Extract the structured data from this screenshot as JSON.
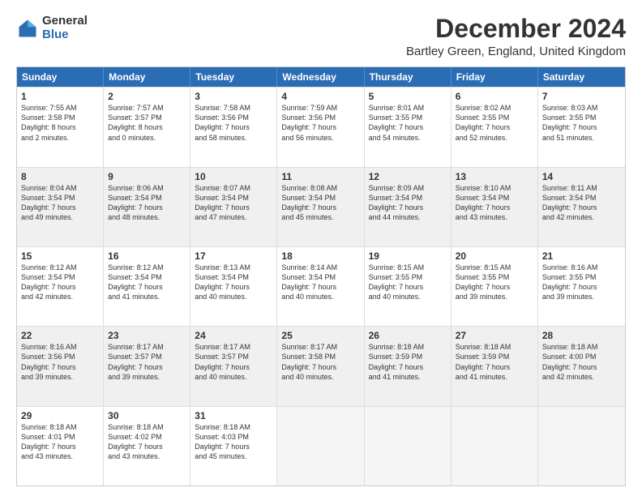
{
  "logo": {
    "general": "General",
    "blue": "Blue"
  },
  "title": "December 2024",
  "subtitle": "Bartley Green, England, United Kingdom",
  "headers": [
    "Sunday",
    "Monday",
    "Tuesday",
    "Wednesday",
    "Thursday",
    "Friday",
    "Saturday"
  ],
  "rows": [
    [
      {
        "day": "1",
        "lines": [
          "Sunrise: 7:55 AM",
          "Sunset: 3:58 PM",
          "Daylight: 8 hours",
          "and 2 minutes."
        ],
        "shaded": false
      },
      {
        "day": "2",
        "lines": [
          "Sunrise: 7:57 AM",
          "Sunset: 3:57 PM",
          "Daylight: 8 hours",
          "and 0 minutes."
        ],
        "shaded": false
      },
      {
        "day": "3",
        "lines": [
          "Sunrise: 7:58 AM",
          "Sunset: 3:56 PM",
          "Daylight: 7 hours",
          "and 58 minutes."
        ],
        "shaded": false
      },
      {
        "day": "4",
        "lines": [
          "Sunrise: 7:59 AM",
          "Sunset: 3:56 PM",
          "Daylight: 7 hours",
          "and 56 minutes."
        ],
        "shaded": false
      },
      {
        "day": "5",
        "lines": [
          "Sunrise: 8:01 AM",
          "Sunset: 3:55 PM",
          "Daylight: 7 hours",
          "and 54 minutes."
        ],
        "shaded": false
      },
      {
        "day": "6",
        "lines": [
          "Sunrise: 8:02 AM",
          "Sunset: 3:55 PM",
          "Daylight: 7 hours",
          "and 52 minutes."
        ],
        "shaded": false
      },
      {
        "day": "7",
        "lines": [
          "Sunrise: 8:03 AM",
          "Sunset: 3:55 PM",
          "Daylight: 7 hours",
          "and 51 minutes."
        ],
        "shaded": false
      }
    ],
    [
      {
        "day": "8",
        "lines": [
          "Sunrise: 8:04 AM",
          "Sunset: 3:54 PM",
          "Daylight: 7 hours",
          "and 49 minutes."
        ],
        "shaded": true
      },
      {
        "day": "9",
        "lines": [
          "Sunrise: 8:06 AM",
          "Sunset: 3:54 PM",
          "Daylight: 7 hours",
          "and 48 minutes."
        ],
        "shaded": true
      },
      {
        "day": "10",
        "lines": [
          "Sunrise: 8:07 AM",
          "Sunset: 3:54 PM",
          "Daylight: 7 hours",
          "and 47 minutes."
        ],
        "shaded": true
      },
      {
        "day": "11",
        "lines": [
          "Sunrise: 8:08 AM",
          "Sunset: 3:54 PM",
          "Daylight: 7 hours",
          "and 45 minutes."
        ],
        "shaded": true
      },
      {
        "day": "12",
        "lines": [
          "Sunrise: 8:09 AM",
          "Sunset: 3:54 PM",
          "Daylight: 7 hours",
          "and 44 minutes."
        ],
        "shaded": true
      },
      {
        "day": "13",
        "lines": [
          "Sunrise: 8:10 AM",
          "Sunset: 3:54 PM",
          "Daylight: 7 hours",
          "and 43 minutes."
        ],
        "shaded": true
      },
      {
        "day": "14",
        "lines": [
          "Sunrise: 8:11 AM",
          "Sunset: 3:54 PM",
          "Daylight: 7 hours",
          "and 42 minutes."
        ],
        "shaded": true
      }
    ],
    [
      {
        "day": "15",
        "lines": [
          "Sunrise: 8:12 AM",
          "Sunset: 3:54 PM",
          "Daylight: 7 hours",
          "and 42 minutes."
        ],
        "shaded": false
      },
      {
        "day": "16",
        "lines": [
          "Sunrise: 8:12 AM",
          "Sunset: 3:54 PM",
          "Daylight: 7 hours",
          "and 41 minutes."
        ],
        "shaded": false
      },
      {
        "day": "17",
        "lines": [
          "Sunrise: 8:13 AM",
          "Sunset: 3:54 PM",
          "Daylight: 7 hours",
          "and 40 minutes."
        ],
        "shaded": false
      },
      {
        "day": "18",
        "lines": [
          "Sunrise: 8:14 AM",
          "Sunset: 3:54 PM",
          "Daylight: 7 hours",
          "and 40 minutes."
        ],
        "shaded": false
      },
      {
        "day": "19",
        "lines": [
          "Sunrise: 8:15 AM",
          "Sunset: 3:55 PM",
          "Daylight: 7 hours",
          "and 40 minutes."
        ],
        "shaded": false
      },
      {
        "day": "20",
        "lines": [
          "Sunrise: 8:15 AM",
          "Sunset: 3:55 PM",
          "Daylight: 7 hours",
          "and 39 minutes."
        ],
        "shaded": false
      },
      {
        "day": "21",
        "lines": [
          "Sunrise: 8:16 AM",
          "Sunset: 3:55 PM",
          "Daylight: 7 hours",
          "and 39 minutes."
        ],
        "shaded": false
      }
    ],
    [
      {
        "day": "22",
        "lines": [
          "Sunrise: 8:16 AM",
          "Sunset: 3:56 PM",
          "Daylight: 7 hours",
          "and 39 minutes."
        ],
        "shaded": true
      },
      {
        "day": "23",
        "lines": [
          "Sunrise: 8:17 AM",
          "Sunset: 3:57 PM",
          "Daylight: 7 hours",
          "and 39 minutes."
        ],
        "shaded": true
      },
      {
        "day": "24",
        "lines": [
          "Sunrise: 8:17 AM",
          "Sunset: 3:57 PM",
          "Daylight: 7 hours",
          "and 40 minutes."
        ],
        "shaded": true
      },
      {
        "day": "25",
        "lines": [
          "Sunrise: 8:17 AM",
          "Sunset: 3:58 PM",
          "Daylight: 7 hours",
          "and 40 minutes."
        ],
        "shaded": true
      },
      {
        "day": "26",
        "lines": [
          "Sunrise: 8:18 AM",
          "Sunset: 3:59 PM",
          "Daylight: 7 hours",
          "and 41 minutes."
        ],
        "shaded": true
      },
      {
        "day": "27",
        "lines": [
          "Sunrise: 8:18 AM",
          "Sunset: 3:59 PM",
          "Daylight: 7 hours",
          "and 41 minutes."
        ],
        "shaded": true
      },
      {
        "day": "28",
        "lines": [
          "Sunrise: 8:18 AM",
          "Sunset: 4:00 PM",
          "Daylight: 7 hours",
          "and 42 minutes."
        ],
        "shaded": true
      }
    ],
    [
      {
        "day": "29",
        "lines": [
          "Sunrise: 8:18 AM",
          "Sunset: 4:01 PM",
          "Daylight: 7 hours",
          "and 43 minutes."
        ],
        "shaded": false
      },
      {
        "day": "30",
        "lines": [
          "Sunrise: 8:18 AM",
          "Sunset: 4:02 PM",
          "Daylight: 7 hours",
          "and 43 minutes."
        ],
        "shaded": false
      },
      {
        "day": "31",
        "lines": [
          "Sunrise: 8:18 AM",
          "Sunset: 4:03 PM",
          "Daylight: 7 hours",
          "and 45 minutes."
        ],
        "shaded": false
      },
      {
        "day": "",
        "lines": [],
        "shaded": true,
        "empty": true
      },
      {
        "day": "",
        "lines": [],
        "shaded": true,
        "empty": true
      },
      {
        "day": "",
        "lines": [],
        "shaded": true,
        "empty": true
      },
      {
        "day": "",
        "lines": [],
        "shaded": true,
        "empty": true
      }
    ]
  ]
}
